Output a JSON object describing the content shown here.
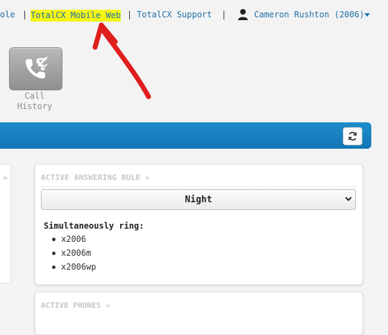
{
  "nav": {
    "console_fragment": "ole",
    "separator": "|",
    "mobile_web": "TotalCX Mobile Web",
    "support": "TotalCX Support",
    "user": "Cameron Rushton (2006)"
  },
  "apps": [
    {
      "label_line1": "Call",
      "label_line2": "History",
      "icon": "phone-arrows-icon"
    }
  ],
  "answering_rule": {
    "title": "ACTIVE ANSWERING RULE »",
    "selected": "Night",
    "simultaneous_label": "Simultaneously ring:",
    "extensions": [
      "x2006",
      "x2006m",
      "x2006wp"
    ]
  },
  "phones": {
    "title": "ACTIVE PHONES »"
  },
  "colors": {
    "link": "#1f6fa8",
    "highlight": "#f5f515",
    "bar": "#1476b6",
    "annotation": "#e01e1e"
  }
}
